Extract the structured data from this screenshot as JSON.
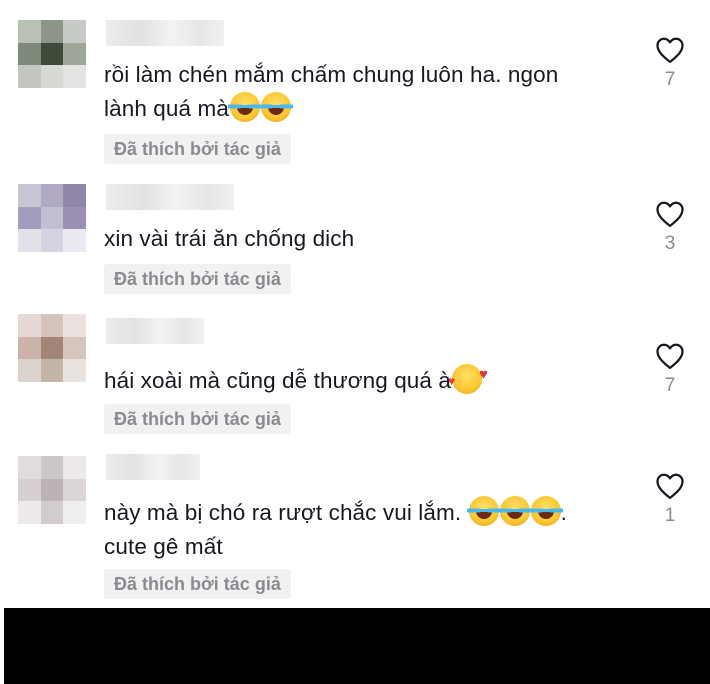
{
  "comments": [
    {
      "text": "rồi làm chén mắm chấm chung luôn ha. ngon",
      "text2": "lành quá mà",
      "liked_by_author": "Đã thích bởi tác giả",
      "likes": "7",
      "emojis": [
        "face-with-tears-of-joy",
        "face-with-tears-of-joy"
      ]
    },
    {
      "text": "xin vài trái ăn chống dich",
      "liked_by_author": "Đã thích bởi tác giả",
      "likes": "3"
    },
    {
      "text": "hái xoài mà cũng dễ thương quá à",
      "liked_by_author": "Đã thích bởi tác giả",
      "likes": "7",
      "emojis": [
        "smiling-face-with-hearts"
      ]
    },
    {
      "text": "này mà bị chó ra rượt chắc vui lắm.",
      "text_after_emoji": ".",
      "text2": "cute gê mất",
      "liked_by_author": "Đã thích bởi tác giả",
      "likes": "1",
      "emojis": [
        "face-with-tears-of-joy",
        "face-with-tears-of-joy",
        "face-with-tears-of-joy"
      ]
    }
  ],
  "colors": {
    "text": "#161823",
    "muted": "#8a8b91",
    "pill_bg": "#f1f1f2",
    "bottom_bar": "#000000"
  },
  "icons": {
    "like": "heart-outline-icon"
  }
}
